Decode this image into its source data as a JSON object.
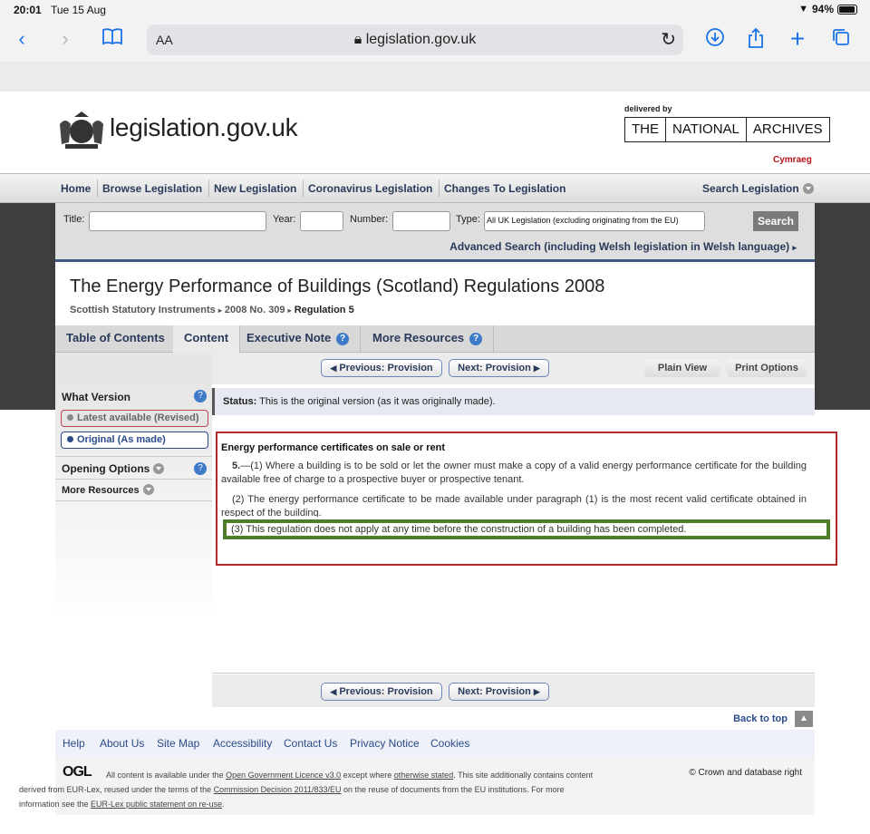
{
  "status_bar": {
    "time": "20:01",
    "date": "Tue 15 Aug",
    "battery": "94%"
  },
  "browser": {
    "text_size": "AA",
    "url": "legislation.gov.uk"
  },
  "header": {
    "site_name": "legislation.gov.uk",
    "delivered_by": "delivered by",
    "archives": [
      "THE",
      "NATIONAL",
      "ARCHIVES"
    ],
    "language_link": "Cymraeg"
  },
  "nav": {
    "items": [
      "Home",
      "Browse Legislation",
      "New Legislation",
      "Coronavirus Legislation",
      "Changes To Legislation"
    ],
    "search_label": "Search Legislation"
  },
  "search": {
    "title_label": "Title:",
    "year_label": "Year:",
    "number_label": "Number:",
    "type_label": "Type:",
    "type_value": "All UK Legislation (excluding originating from the EU)",
    "button": "Search",
    "advanced": "Advanced Search (including Welsh legislation in Welsh language)"
  },
  "page": {
    "title": "The Energy Performance of Buildings (Scotland) Regulations 2008",
    "breadcrumb": [
      "Scottish Statutory Instruments",
      "2008 No. 309",
      "Regulation 5"
    ]
  },
  "tabs": [
    "Table of Contents",
    "Content",
    "Executive Note",
    "More Resources"
  ],
  "provision": {
    "previous": "Previous: Provision",
    "next": "Next: Provision"
  },
  "view": {
    "plain": "Plain View",
    "print": "Print Options"
  },
  "sidebar": {
    "what_version": "What Version",
    "latest": "Latest available (Revised)",
    "original": "Original (As made)",
    "opening_options": "Opening Options",
    "more_resources": "More Resources"
  },
  "status": {
    "label": "Status:",
    "text": "This is the original version (as it was originally made)."
  },
  "content": {
    "heading": "Energy performance certificates on sale or rent",
    "para1_num": "5.",
    "para1": "—(1) Where a building is to be sold or let the owner must make a copy of a valid energy performance certificate for the building available free of charge to a prospective buyer or prospective tenant.",
    "para2": "(2) The energy performance certificate to be made available under paragraph (1) is the most recent valid certificate obtained in respect of the building.",
    "para3": "(3) This regulation does not apply at any time before the construction of a building has been completed."
  },
  "footer": {
    "back_to_top": "Back to top",
    "links": [
      "Help",
      "About Us",
      "Site Map",
      "Accessibility",
      "Contact Us",
      "Privacy Notice",
      "Cookies"
    ],
    "ogl": "OGL",
    "licence_line1_a": "All content is available under the ",
    "licence_link1": "Open Government Licence v3.0",
    "licence_line1_b": " except where ",
    "licence_link2": "otherwise stated",
    "licence_line1_c": ". This site additionally contains content",
    "licence_line2_a": "derived from EUR-Lex, reused under the terms of the ",
    "licence_link3": "Commission Decision 2011/833/EU",
    "licence_line2_b": " on the reuse of documents from the EU institutions. For more",
    "licence_line3_a": "information see the ",
    "licence_link4": "EUR-Lex public statement on re-use",
    "licence_line3_b": ".",
    "copyright": "© Crown and database right"
  }
}
